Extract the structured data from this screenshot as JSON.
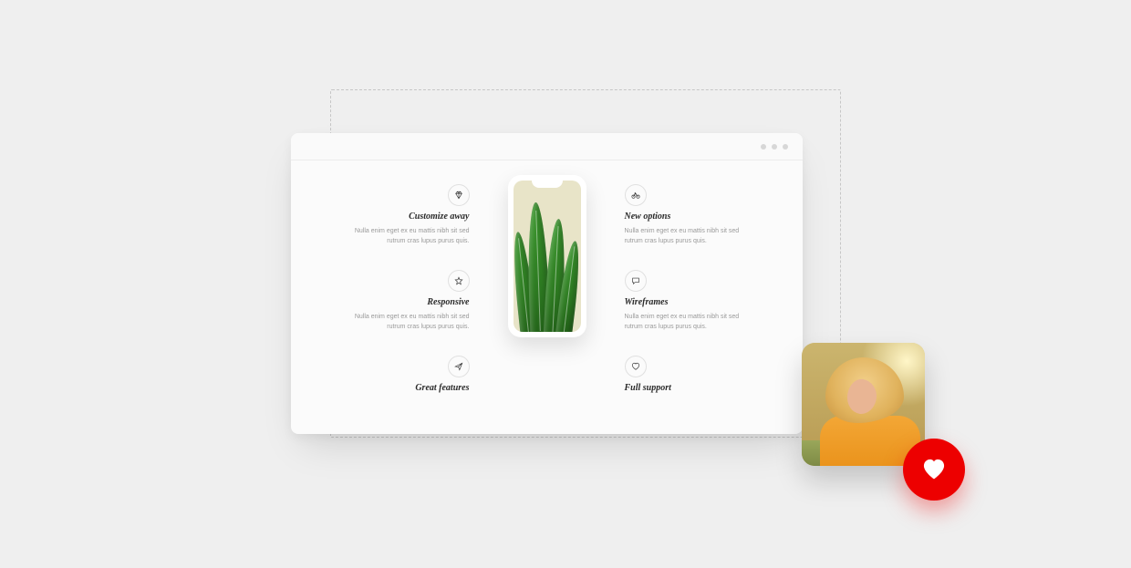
{
  "features_left": [
    {
      "icon": "diamond-icon",
      "title": "Customize away",
      "desc": "Nulla enim eget ex eu mattis nibh sit sed rutrum cras lupus purus quis."
    },
    {
      "icon": "star-icon",
      "title": "Responsive",
      "desc": "Nulla enim eget ex eu mattis nibh sit sed rutrum cras lupus purus quis."
    },
    {
      "icon": "paperplane-icon",
      "title": "Great features",
      "desc": ""
    }
  ],
  "features_right": [
    {
      "icon": "bike-icon",
      "title": "New options",
      "desc": "Nulla enim eget ex eu mattis nibh sit sed rutrum cras lupus purus quis."
    },
    {
      "icon": "chat-icon",
      "title": "Wireframes",
      "desc": "Nulla enim eget ex eu mattis nibh sit sed rutrum cras lupus purus quis."
    },
    {
      "icon": "heart-icon",
      "title": "Full support",
      "desc": ""
    }
  ],
  "heart_button": {
    "icon": "heart-filled-icon"
  }
}
